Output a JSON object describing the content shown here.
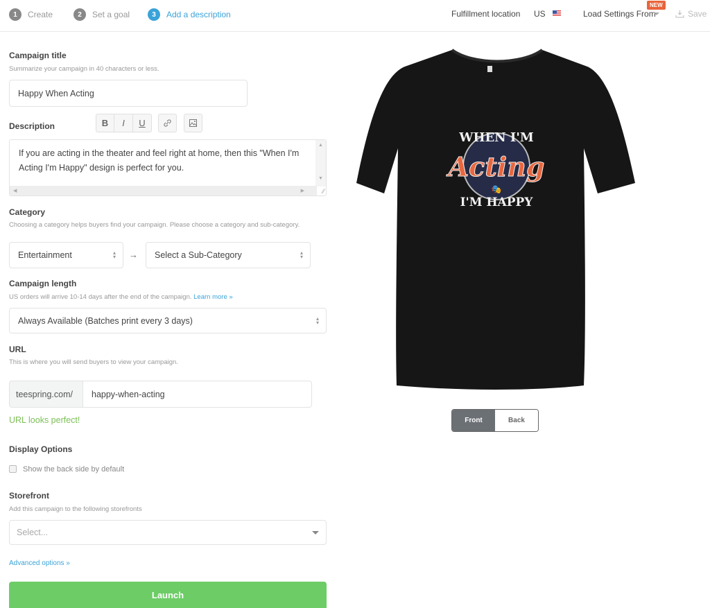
{
  "steps": [
    {
      "number": "1",
      "label": "Create",
      "state": "done"
    },
    {
      "number": "2",
      "label": "Set a goal",
      "state": "done"
    },
    {
      "number": "3",
      "label": "Add a description",
      "state": "active"
    }
  ],
  "header": {
    "fulfillment_label": "Fulfillment location",
    "fulfillment_country": "US",
    "load_settings_label": "Load Settings From",
    "new_badge": "NEW",
    "save_label": "Save"
  },
  "campaign_title": {
    "label": "Campaign title",
    "help": "Summarize your campaign in 40 characters or less.",
    "value": "Happy When Acting"
  },
  "description": {
    "label": "Description",
    "toolbar": [
      "B",
      "I",
      "U"
    ],
    "value": "If you are acting in the theater and feel right at home, then this \"When I'm Acting I'm Happy\" design is perfect for you."
  },
  "category": {
    "label": "Category",
    "help": "Choosing a category helps buyers find your campaign. Please choose a category and sub-category.",
    "value": "Entertainment",
    "arrow": "→",
    "sub_value": "Select a Sub-Category"
  },
  "campaign_length": {
    "label": "Campaign length",
    "help": "US orders will arrive 10-14 days after the end of the campaign.",
    "learn_more": "Learn more »",
    "value": "Always Available (Batches print every 3 days)"
  },
  "url": {
    "label": "URL",
    "help": "This is where you will send buyers to view your campaign.",
    "prefix": "teespring.com/",
    "value": "happy-when-acting",
    "status": "URL looks perfect!"
  },
  "display_options": {
    "label": "Display Options",
    "checkbox_label": "Show the back side by default",
    "checked": false
  },
  "storefront": {
    "label": "Storefront",
    "help": "Add this campaign to the following storefronts",
    "placeholder": "Select..."
  },
  "advanced_link": "Advanced options »",
  "launch_label": "Launch",
  "preview": {
    "design_top": "WHEN I'M",
    "design_main": "Acting",
    "design_bottom": "I'M HAPPY",
    "front_label": "Front",
    "back_label": "Back",
    "active_side": "Front"
  },
  "colors": {
    "accent": "#3aa3d8",
    "launch": "#6dcc66",
    "success": "#7cc057",
    "design_orange": "#e8673f",
    "design_navy": "#262b47"
  }
}
